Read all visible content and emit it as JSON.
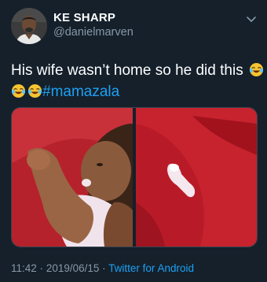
{
  "tweet": {
    "author": {
      "display_name": "KE SHARP",
      "handle": "@danielmarven",
      "avatar_icon": "avatar-photo"
    },
    "menu_icon": "chevron-down-icon",
    "text": {
      "line1": "His wife wasn’t home so he did this",
      "hashtag": "#mamazala",
      "emoji": "face-with-tears-of-joy"
    },
    "media": {
      "image_count": 2
    },
    "meta": {
      "time": "11:42",
      "separator1": "·",
      "date": "2019/06/15",
      "separator2": "·",
      "source": "Twitter for Android"
    }
  },
  "colors": {
    "background": "#15202b",
    "text": "#ffffff",
    "secondary": "#8899a6",
    "accent": "#1da1f2"
  }
}
